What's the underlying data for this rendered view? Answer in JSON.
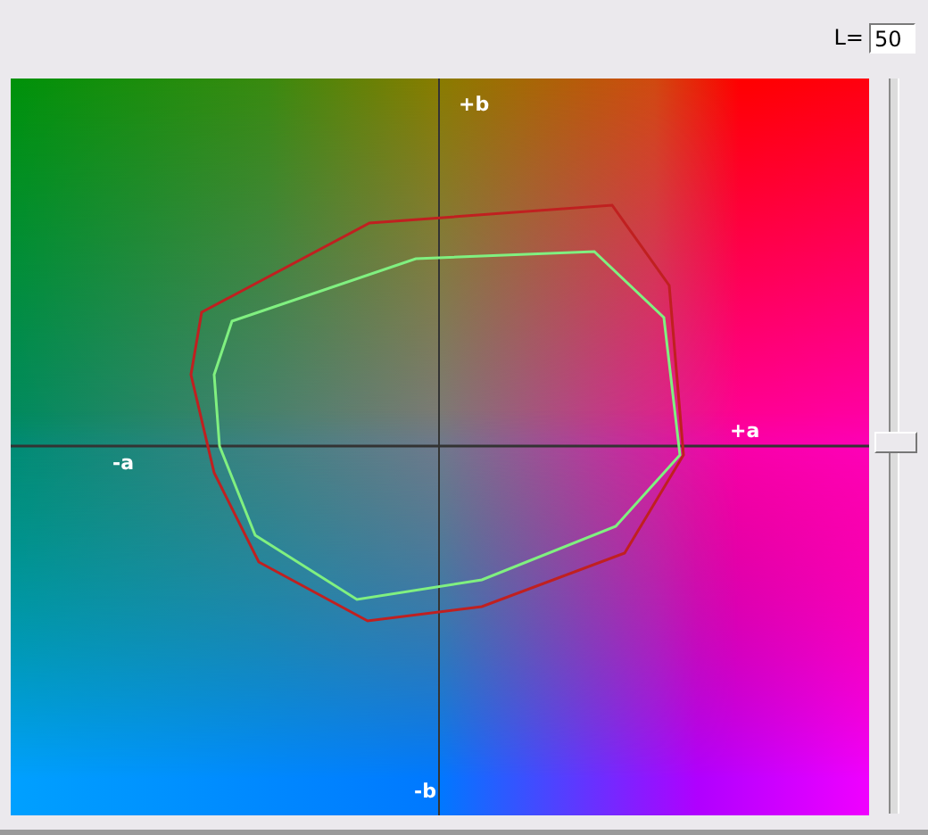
{
  "lightness": {
    "label": "L=",
    "value": "50"
  },
  "slider": {
    "level": 0.5
  },
  "plot": {
    "axis_labels": [
      {
        "text": "+b",
        "kind": "top"
      },
      {
        "text": "-a",
        "kind": "left"
      },
      {
        "text": "+a",
        "kind": "right"
      },
      {
        "text": "-b",
        "kind": "bottom"
      }
    ]
  }
}
